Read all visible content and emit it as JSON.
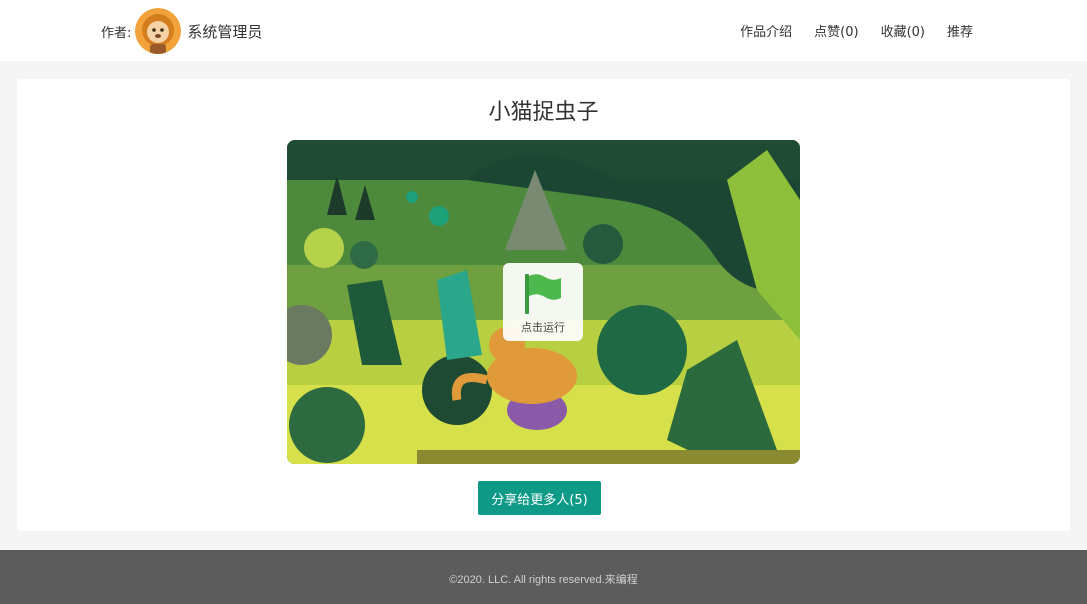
{
  "header": {
    "author_label": "作者:",
    "author_name": "系统管理员",
    "nav": [
      {
        "label": "作品介绍"
      },
      {
        "label": "点赞(0)"
      },
      {
        "label": "收藏(0)"
      },
      {
        "label": "推荐"
      }
    ]
  },
  "project": {
    "title": "小猫捉虫子",
    "run_label": "点击运行",
    "share_label": "分享给更多人(5)"
  },
  "footer": {
    "text": "©2020. LLC. All rights reserved.来编程"
  },
  "colors": {
    "accent": "#0f9a87",
    "flag": "#4cb84e",
    "footer_bg": "#5c5c5c"
  },
  "icons": {
    "avatar": "lion-avatar-icon",
    "run": "green-flag-icon"
  }
}
